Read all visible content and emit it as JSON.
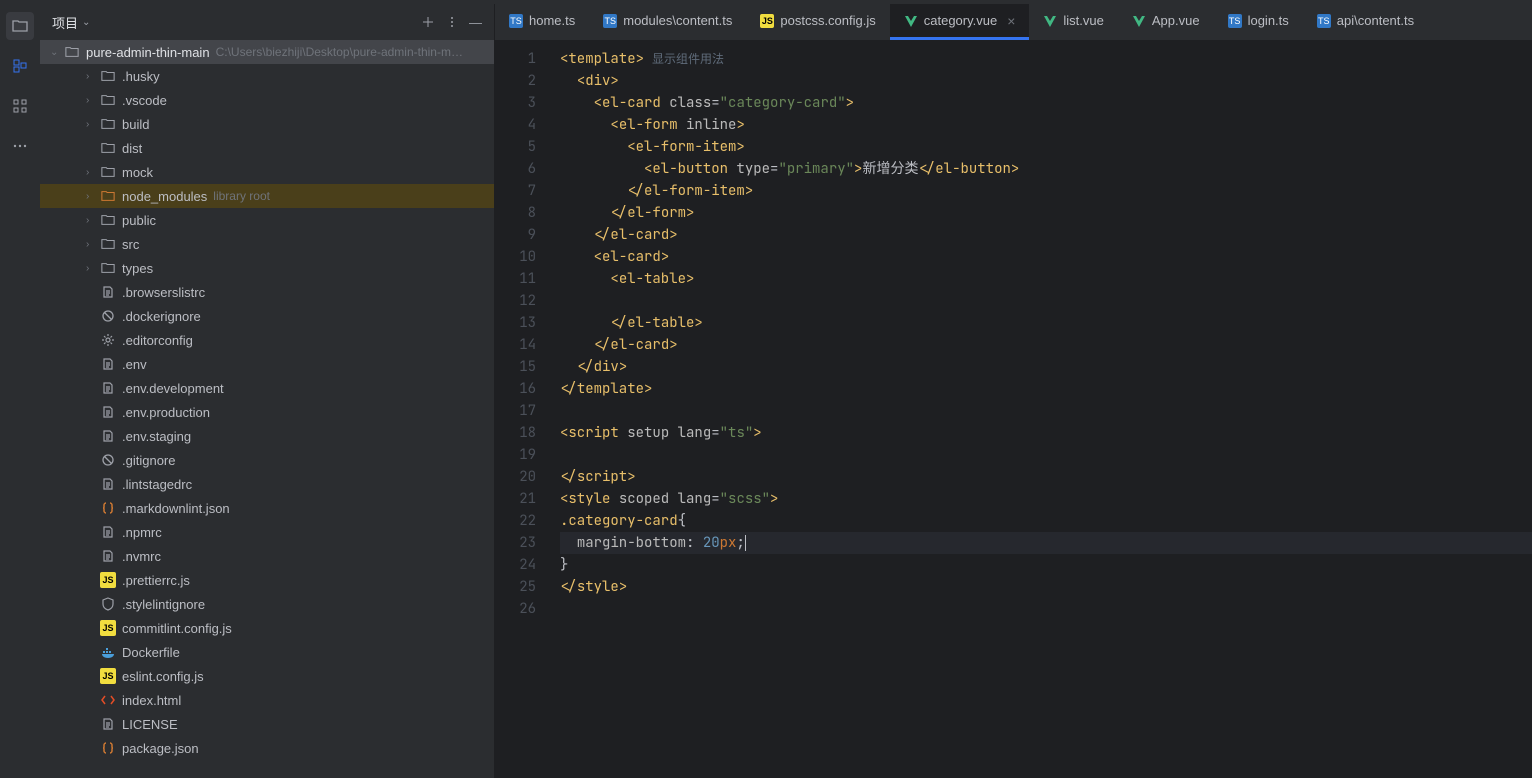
{
  "project_label": "项目",
  "project_root": {
    "name": "pure-admin-thin-main",
    "path": "C:\\Users\\biezhiji\\Desktop\\pure-admin-thin-m…"
  },
  "tree": [
    {
      "indent": 1,
      "chev": true,
      "icon": "folder",
      "label": ".husky"
    },
    {
      "indent": 1,
      "chev": true,
      "icon": "folder",
      "label": ".vscode"
    },
    {
      "indent": 1,
      "chev": true,
      "icon": "folder",
      "label": "build"
    },
    {
      "indent": 1,
      "chev": false,
      "icon": "folder",
      "label": "dist"
    },
    {
      "indent": 1,
      "chev": true,
      "icon": "folder",
      "label": "mock"
    },
    {
      "indent": 1,
      "chev": true,
      "icon": "folder-orange",
      "label": "node_modules",
      "hint": "library root",
      "highlight": true
    },
    {
      "indent": 1,
      "chev": true,
      "icon": "folder",
      "label": "public"
    },
    {
      "indent": 1,
      "chev": true,
      "icon": "folder",
      "label": "src"
    },
    {
      "indent": 1,
      "chev": true,
      "icon": "folder",
      "label": "types"
    },
    {
      "indent": 1,
      "chev": false,
      "icon": "text",
      "label": ".browserslistrc"
    },
    {
      "indent": 1,
      "chev": false,
      "icon": "ban",
      "label": ".dockerignore"
    },
    {
      "indent": 1,
      "chev": false,
      "icon": "gear",
      "label": ".editorconfig"
    },
    {
      "indent": 1,
      "chev": false,
      "icon": "text",
      "label": ".env"
    },
    {
      "indent": 1,
      "chev": false,
      "icon": "text",
      "label": ".env.development"
    },
    {
      "indent": 1,
      "chev": false,
      "icon": "text",
      "label": ".env.production"
    },
    {
      "indent": 1,
      "chev": false,
      "icon": "text",
      "label": ".env.staging"
    },
    {
      "indent": 1,
      "chev": false,
      "icon": "ban",
      "label": ".gitignore"
    },
    {
      "indent": 1,
      "chev": false,
      "icon": "text",
      "label": ".lintstagedrc"
    },
    {
      "indent": 1,
      "chev": false,
      "icon": "json",
      "label": ".markdownlint.json"
    },
    {
      "indent": 1,
      "chev": false,
      "icon": "text",
      "label": ".npmrc"
    },
    {
      "indent": 1,
      "chev": false,
      "icon": "text",
      "label": ".nvmrc"
    },
    {
      "indent": 1,
      "chev": false,
      "icon": "js",
      "label": ".prettierrc.js"
    },
    {
      "indent": 1,
      "chev": false,
      "icon": "shield",
      "label": ".stylelintignore"
    },
    {
      "indent": 1,
      "chev": false,
      "icon": "js",
      "label": "commitlint.config.js"
    },
    {
      "indent": 1,
      "chev": false,
      "icon": "docker",
      "label": "Dockerfile"
    },
    {
      "indent": 1,
      "chev": false,
      "icon": "js",
      "label": "eslint.config.js"
    },
    {
      "indent": 1,
      "chev": false,
      "icon": "html",
      "label": "index.html"
    },
    {
      "indent": 1,
      "chev": false,
      "icon": "text",
      "label": "LICENSE"
    },
    {
      "indent": 1,
      "chev": false,
      "icon": "json",
      "label": "package.json"
    }
  ],
  "tabs": [
    {
      "icon": "ts",
      "label": "home.ts"
    },
    {
      "icon": "ts",
      "label": "modules\\content.ts"
    },
    {
      "icon": "js",
      "label": "postcss.config.js"
    },
    {
      "icon": "vue",
      "label": "category.vue",
      "active": true,
      "close": true
    },
    {
      "icon": "vue",
      "label": "list.vue"
    },
    {
      "icon": "vue",
      "label": "App.vue"
    },
    {
      "icon": "ts",
      "label": "login.ts"
    },
    {
      "icon": "ts",
      "label": "api\\content.ts"
    }
  ],
  "editor": {
    "inline_hint": "显示组件用法",
    "lines": [
      {
        "n": 1,
        "html": "<span class='tk-angle'>&lt;</span><span class='tk-tag'>template</span><span class='tk-angle'>&gt;</span><span class='hint-inline' data-bind='editor.inline_hint'></span>"
      },
      {
        "n": 2,
        "html": "  <span class='tk-angle'>&lt;</span><span class='tk-tag'>div</span><span class='tk-angle'>&gt;</span>"
      },
      {
        "n": 3,
        "html": "    <span class='tk-angle'>&lt;</span><span class='tk-tag'>el-card</span> <span class='tk-attr'>class</span>=<span class='tk-str'>\"category-card\"</span><span class='tk-angle'>&gt;</span>"
      },
      {
        "n": 4,
        "html": "      <span class='tk-angle'>&lt;</span><span class='tk-tag'>el-form</span> <span class='tk-attr'>inline</span><span class='tk-angle'>&gt;</span>"
      },
      {
        "n": 5,
        "html": "        <span class='tk-angle'>&lt;</span><span class='tk-tag'>el-form-item</span><span class='tk-angle'>&gt;</span>"
      },
      {
        "n": 6,
        "html": "          <span class='tk-angle'>&lt;</span><span class='tk-tag'>el-button</span> <span class='tk-attr'>type</span>=<span class='tk-str'>\"primary\"</span><span class='tk-angle'>&gt;</span><span class='tk-txt'>新增分类</span><span class='tk-angle'>&lt;/</span><span class='tk-tag'>el-button</span><span class='tk-angle'>&gt;</span>"
      },
      {
        "n": 7,
        "html": "        <span class='tk-angle'>&lt;/</span><span class='tk-tag'>el-form-item</span><span class='tk-angle'>&gt;</span>"
      },
      {
        "n": 8,
        "html": "      <span class='tk-angle'>&lt;/</span><span class='tk-tag'>el-form</span><span class='tk-angle'>&gt;</span>"
      },
      {
        "n": 9,
        "html": "    <span class='tk-angle'>&lt;/</span><span class='tk-tag'>el-card</span><span class='tk-angle'>&gt;</span>"
      },
      {
        "n": 10,
        "html": "    <span class='tk-angle'>&lt;</span><span class='tk-tag'>el-card</span><span class='tk-angle'>&gt;</span>"
      },
      {
        "n": 11,
        "html": "      <span class='tk-angle'>&lt;</span><span class='tk-tag'>el-table</span><span class='tk-angle'>&gt;</span>"
      },
      {
        "n": 12,
        "html": ""
      },
      {
        "n": 13,
        "html": "      <span class='tk-angle'>&lt;/</span><span class='tk-tag'>el-table</span><span class='tk-angle'>&gt;</span>"
      },
      {
        "n": 14,
        "html": "    <span class='tk-angle'>&lt;/</span><span class='tk-tag'>el-card</span><span class='tk-angle'>&gt;</span>"
      },
      {
        "n": 15,
        "html": "  <span class='tk-angle'>&lt;/</span><span class='tk-tag'>div</span><span class='tk-angle'>&gt;</span>"
      },
      {
        "n": 16,
        "html": "<span class='tk-angle'>&lt;/</span><span class='tk-tag'>template</span><span class='tk-angle'>&gt;</span>"
      },
      {
        "n": 17,
        "html": ""
      },
      {
        "n": 18,
        "html": "<span class='tk-angle'>&lt;</span><span class='tk-tag'>script</span> <span class='tk-attr'>setup</span> <span class='tk-attr'>lang</span>=<span class='tk-str'>\"ts\"</span><span class='tk-angle'>&gt;</span>"
      },
      {
        "n": 19,
        "html": ""
      },
      {
        "n": 20,
        "html": "<span class='tk-angle'>&lt;/</span><span class='tk-tag'>script</span><span class='tk-angle'>&gt;</span>"
      },
      {
        "n": 21,
        "html": "<span class='tk-angle'>&lt;</span><span class='tk-tag'>style</span> <span class='tk-attr'>scoped</span> <span class='tk-attr'>lang</span>=<span class='tk-str'>\"scss\"</span><span class='tk-angle'>&gt;</span>"
      },
      {
        "n": 22,
        "html": "<span class='tk-sel'>.category-card</span><span class='tk-txt'>{</span>"
      },
      {
        "n": 23,
        "current": true,
        "html": "  <span class='tk-prop'>margin-bottom</span><span class='tk-txt'>: </span><span class='tk-num'>20</span><span class='tk-unit'>px</span><span class='tk-txt'>;</span><span class='cursor'></span>"
      },
      {
        "n": 24,
        "html": "<span class='tk-txt'>}</span>"
      },
      {
        "n": 25,
        "html": "<span class='tk-angle'>&lt;/</span><span class='tk-tag'>style</span><span class='tk-angle'>&gt;</span>"
      },
      {
        "n": 26,
        "html": ""
      }
    ]
  }
}
